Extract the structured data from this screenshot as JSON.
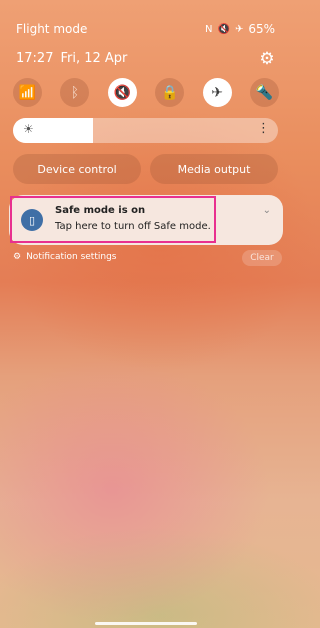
{
  "status_bar": {
    "mode": "Flight mode",
    "battery": "65%",
    "icons": [
      "nfc-icon",
      "mute-icon",
      "airplane-icon"
    ]
  },
  "header": {
    "time": "17:27",
    "date": "Fri, 12 Apr"
  },
  "quick_tiles": [
    {
      "name": "wifi",
      "active": false
    },
    {
      "name": "bluetooth",
      "active": false
    },
    {
      "name": "sound-mute",
      "active": true
    },
    {
      "name": "rotation-lock",
      "active": false
    },
    {
      "name": "airplane-mode",
      "active": true
    },
    {
      "name": "flashlight",
      "active": false
    }
  ],
  "brightness": {
    "level": 0.3
  },
  "buttons": {
    "device_control": "Device control",
    "media_output": "Media output"
  },
  "notification": {
    "title": "Safe mode is on",
    "body": "Tap here to turn off Safe mode."
  },
  "footer": {
    "notification_settings": "Notification settings",
    "clear": "Clear"
  }
}
